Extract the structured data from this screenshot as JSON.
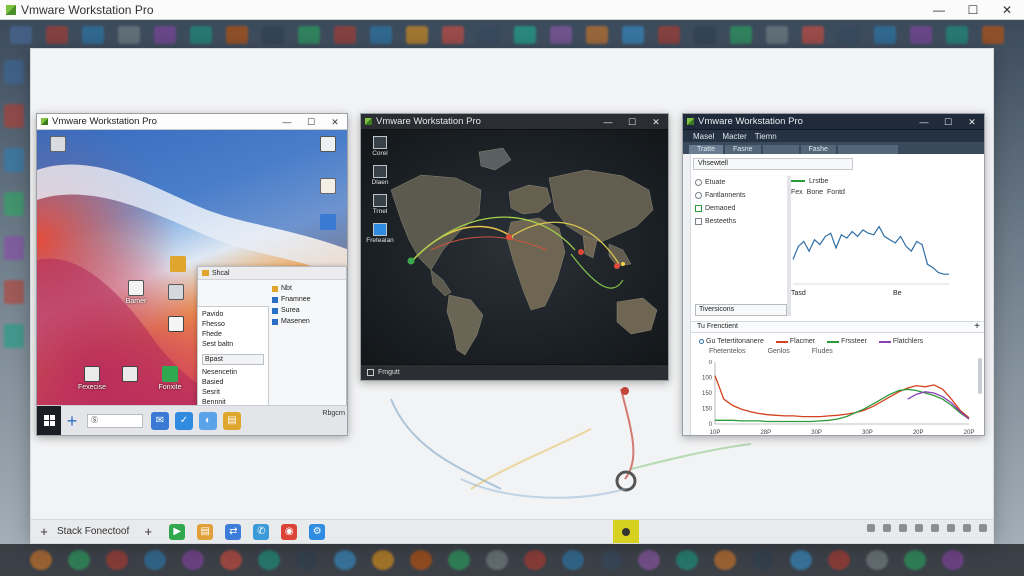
{
  "host": {
    "title": "Vmware Workstation Pro",
    "controls": {
      "minimize": "—",
      "maximize": "☐",
      "close": "✕"
    }
  },
  "workspace": {
    "taskbar": {
      "start_glyph": "+",
      "label": "Stack Fonectoof",
      "plus_glyph": "+"
    }
  },
  "vm1": {
    "title": "Vmware Workstation Pro",
    "controls": {
      "minimize": "—",
      "maximize": "☐",
      "close": "✕"
    },
    "desktop_icons": [
      {
        "label": "Bamer"
      },
      {
        "label": "Fexecise"
      },
      {
        "label": "Fonxite"
      }
    ],
    "explorer": {
      "address": "Shcal",
      "menu_items": [
        "Pavido",
        "Fhesso",
        "Fhede",
        "Sest baltn"
      ],
      "search": "Bpast",
      "list_items": [
        "Nesencetin",
        "Basied",
        "Sesrit",
        "Bennnit"
      ],
      "right_items": [
        "Fnamnee",
        "Surea",
        "Masenen"
      ],
      "right_header": "Nbt"
    },
    "taskbar": {
      "search_placeholder": "Ⓢ",
      "clock": "Rbgcrn"
    }
  },
  "vm2": {
    "title": "Vmware Workstation Pro",
    "controls": {
      "minimize": "—",
      "maximize": "☐",
      "close": "✕"
    },
    "side_items": [
      "Corel",
      "Dlaen",
      "Trnel",
      "Fretealan"
    ],
    "status": "Fmgutt"
  },
  "vm3": {
    "title": "Vmware Workstation Pro",
    "controls": {
      "minimize": "—",
      "maximize": "☐",
      "close": "✕"
    },
    "menubar": [
      "Masel",
      "Macter",
      "Tiemn"
    ],
    "tabs": [
      "Tratte",
      "Fasne",
      "",
      "",
      "Fashe",
      ""
    ],
    "toolbar_text": "Vhsewtell",
    "tree": [
      {
        "label": "Etuate"
      },
      {
        "label": "Fantlannents"
      },
      {
        "label": "Demaoed"
      },
      {
        "label": "Besteeths"
      }
    ],
    "dropdown": "Tiversicons",
    "mini_legend": [
      "Lrstbe",
      "Fex",
      "Bone",
      "Fontd"
    ],
    "mini_labels": [
      "Tasd",
      "Be"
    ],
    "section_title": "Tu Frenctient",
    "legend": [
      "Gu Tetertitonanere",
      "Flacmer",
      "Frssteer",
      "Flatchlers"
    ],
    "sublegend": [
      "Fhetentelos",
      "Genlos",
      "Fludes"
    ],
    "colors": {
      "red": "#d2421e",
      "green": "#2b9a3a",
      "purple": "#8a3fb5",
      "blue": "#2e6da4"
    }
  },
  "chart_data": [
    {
      "type": "line",
      "title": "",
      "xlabel": "",
      "ylabel": "",
      "x": [
        0,
        1,
        2,
        3,
        4,
        5,
        6,
        7,
        8,
        9,
        10,
        11,
        12,
        13,
        14,
        15,
        16,
        17,
        18,
        19,
        20,
        21,
        22,
        23,
        24,
        25,
        26,
        27,
        28,
        29
      ],
      "series": [
        {
          "name": "",
          "values": [
            30,
            46,
            52,
            40,
            54,
            48,
            58,
            62,
            44,
            60,
            56,
            64,
            58,
            66,
            62,
            60,
            70,
            58,
            54,
            50,
            58,
            46,
            40,
            52,
            48,
            24,
            20,
            14,
            12,
            12
          ]
        }
      ],
      "ylim": [
        0,
        100
      ]
    },
    {
      "type": "line",
      "title": "",
      "xlabel": "",
      "ylabel": "",
      "xtick_labels": [
        "10P",
        "28P",
        "30P",
        "30P",
        "20P",
        "20P"
      ],
      "ytick_labels": [
        "0",
        "100",
        "150",
        "150",
        "0"
      ],
      "x": [
        0,
        1,
        2,
        3,
        4,
        5,
        6,
        7,
        8,
        9,
        10,
        11,
        12,
        13,
        14,
        15,
        16,
        17,
        18,
        19,
        20,
        21,
        22,
        23,
        24,
        25,
        26,
        27,
        28,
        29
      ],
      "series": [
        {
          "name": "Flacmer",
          "values": [
            78,
            40,
            30,
            24,
            20,
            17,
            15,
            14,
            13,
            13,
            12,
            12,
            12,
            13,
            14,
            16,
            18,
            22,
            28,
            36,
            44,
            52,
            58,
            62,
            60,
            63,
            56,
            40,
            22,
            10
          ]
        },
        {
          "name": "Frssteer",
          "values": [
            6,
            6,
            6,
            5,
            5,
            5,
            4,
            4,
            4,
            4,
            4,
            4,
            5,
            6,
            8,
            12,
            18,
            24,
            32,
            40,
            48,
            54,
            56,
            54,
            50,
            46,
            40,
            30,
            18,
            8
          ]
        },
        {
          "name": "Flatchlers",
          "values": [
            0,
            0,
            0,
            0,
            0,
            0,
            0,
            0,
            0,
            0,
            0,
            0,
            0,
            0,
            0,
            0,
            0,
            0,
            0,
            0,
            0,
            0,
            40,
            48,
            52,
            50,
            44,
            34,
            20,
            8
          ]
        }
      ],
      "ylim": [
        0,
        100
      ]
    }
  ]
}
